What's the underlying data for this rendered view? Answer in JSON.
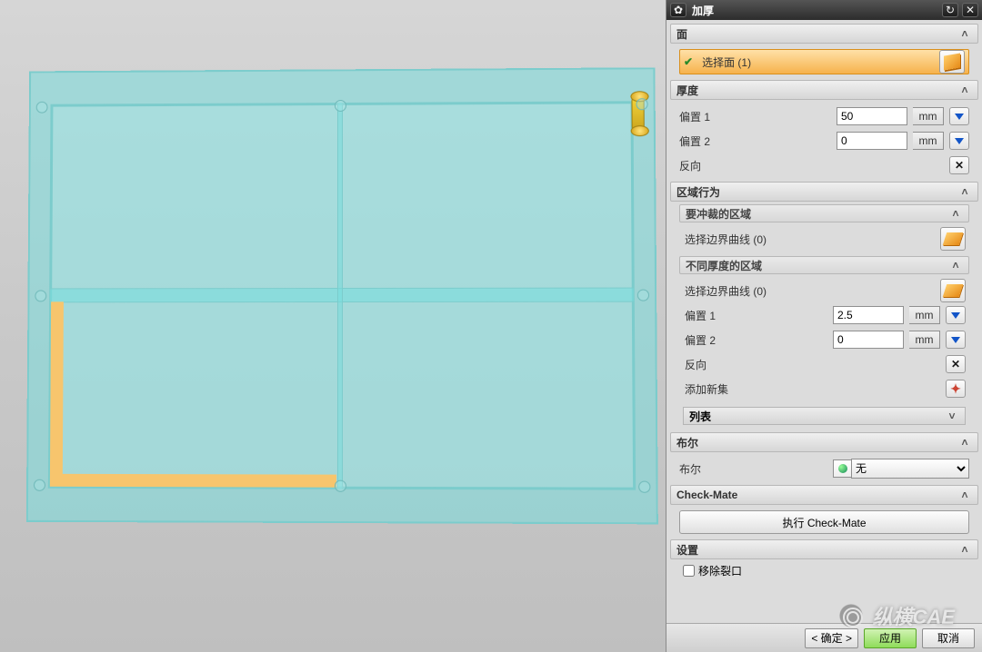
{
  "title": "加厚",
  "sections": {
    "face": {
      "label": "面",
      "select_face": "选择面 (1)"
    },
    "thickness": {
      "label": "厚度",
      "offset1_label": "偏置 1",
      "offset1_value": "50",
      "offset1_unit": "mm",
      "offset2_label": "偏置 2",
      "offset2_value": "0",
      "offset2_unit": "mm",
      "reverse_label": "反向"
    },
    "region": {
      "label": "区域行为",
      "punch": {
        "label": "要冲裁的区域",
        "select_curve": "选择边界曲线 (0)"
      },
      "diff": {
        "label": "不同厚度的区域",
        "select_curve": "选择边界曲线 (0)",
        "offset1_label": "偏置 1",
        "offset1_value": "2.5",
        "offset1_unit": "mm",
        "offset2_label": "偏置 2",
        "offset2_value": "0",
        "offset2_unit": "mm",
        "reverse_label": "反向",
        "addset_label": "添加新集",
        "list_label": "列表"
      }
    },
    "boolean": {
      "label": "布尔",
      "field_label": "布尔",
      "value": "无"
    },
    "checkmate": {
      "label": "Check-Mate",
      "button": "执行 Check-Mate"
    },
    "settings": {
      "label": "设置",
      "remove_crack": "移除裂口"
    }
  },
  "buttons": {
    "ok": "< 确定 >",
    "apply": "应用",
    "cancel": "取消"
  },
  "watermark": "纵横CAE"
}
